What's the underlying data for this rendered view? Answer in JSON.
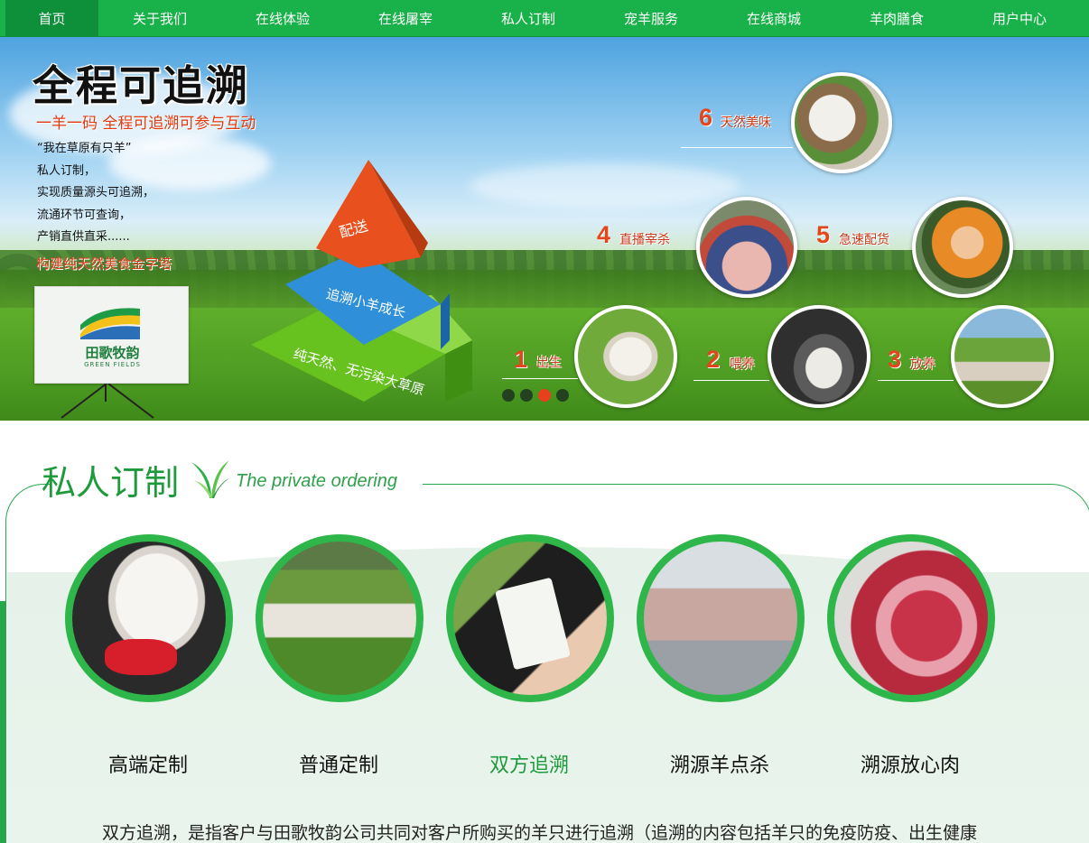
{
  "nav": {
    "items": [
      "首页",
      "关于我们",
      "在线体验",
      "在线屠宰",
      "私人订制",
      "宠羊服务",
      "在线商城",
      "羊肉膳食",
      "用户中心"
    ]
  },
  "banner": {
    "title": "全程可追溯",
    "subtitle": "一羊一码 全程可追溯可参与互动",
    "lines": [
      "“我在草原有只羊”",
      "私人订制，",
      "实现质量源头可追溯，",
      "流通环节可查询，",
      "产销直供直采......"
    ],
    "caption": "构建纯天然美食金字塔",
    "logo_cn": "田歌牧韵",
    "logo_en": "GREEN FIELDS",
    "pyramid": [
      "配送",
      "追溯小羊成长",
      "纯天然、无污染大草原"
    ],
    "steps": [
      {
        "num": "1",
        "label": "出生"
      },
      {
        "num": "2",
        "label": "喂养"
      },
      {
        "num": "3",
        "label": "放养"
      },
      {
        "num": "4",
        "label": "直播宰杀"
      },
      {
        "num": "5",
        "label": "急速配货"
      },
      {
        "num": "6",
        "label": "天然美味"
      }
    ],
    "slider_active": 3,
    "slider_count": 4
  },
  "section": {
    "title": "私人订制",
    "subtitle": "The private ordering",
    "items": [
      "高端定制",
      "普通定制",
      "双方追溯",
      "溯源羊点杀",
      "溯源放心肉"
    ],
    "active_item": 3,
    "description": "双方追溯，是指客户与田歌牧韵公司共同对客户所购买的羊只进行追溯（追溯的内容包括羊只的免疫防疫、出生健康"
  },
  "colors": {
    "nav": "#19b24a",
    "nav_active": "#0e8f39",
    "accent_green": "#1e9a3c",
    "accent_orange": "#e2461c"
  }
}
